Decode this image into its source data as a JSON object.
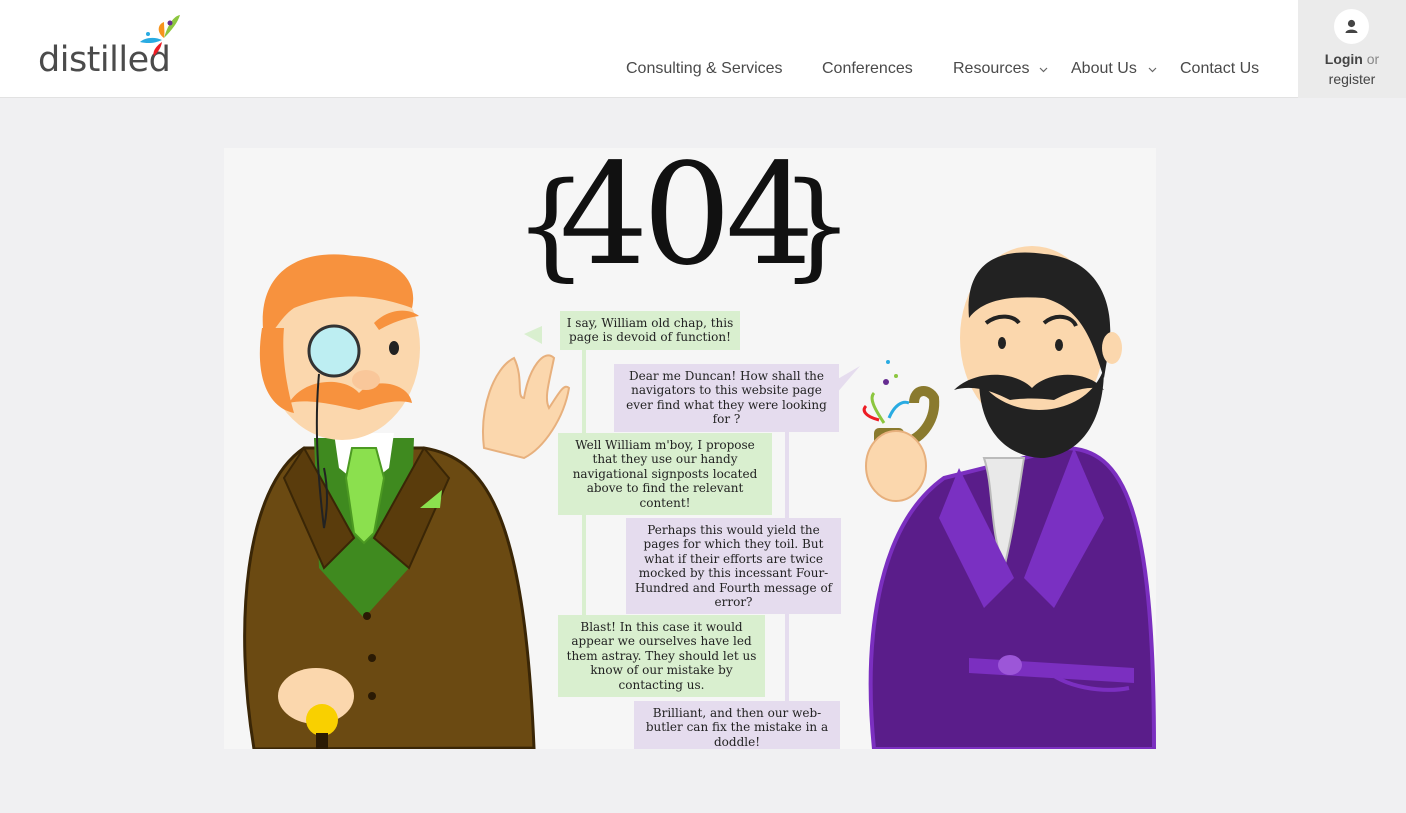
{
  "header": {
    "logo_text": "distilled",
    "nav": [
      {
        "label": "Consulting & Services",
        "has_dropdown": false
      },
      {
        "label": "Conferences",
        "has_dropdown": false
      },
      {
        "label": "Resources",
        "has_dropdown": true
      },
      {
        "label": "About Us",
        "has_dropdown": true
      },
      {
        "label": "Contact Us",
        "has_dropdown": false
      }
    ],
    "login": {
      "icon": "user-icon",
      "login_label": "Login",
      "or_label": "or",
      "register_label": "register"
    }
  },
  "illustration": {
    "title": {
      "open_brace": "{",
      "digits": "404",
      "close_brace": "}"
    },
    "dialogue": [
      {
        "speaker": "left",
        "text": "I say, William old chap, this page is devoid of function!"
      },
      {
        "speaker": "right",
        "text": "Dear me Duncan! How shall the navigators to this website page ever find what they were looking for ?"
      },
      {
        "speaker": "left",
        "text": "Well William m'boy, I propose that they use our handy navigational signposts located above to find the relevant content!"
      },
      {
        "speaker": "right",
        "text": "Perhaps this would yield the pages for which they toil. But what if their efforts are twice mocked by this incessant Four-Hundred and Fourth message of error?"
      },
      {
        "speaker": "left",
        "text": "Blast! In this case it would appear we ourselves have led them astray. They should let us know of our mistake by contacting us."
      },
      {
        "speaker": "right",
        "text": "Brilliant, and then our web-butler can fix the mistake in a doddle!"
      }
    ]
  },
  "colors": {
    "page_bg": "#f0f0f2",
    "green_bubble": "#d9efcf",
    "purple_bubble": "#e5dcee",
    "left_suit": "#6b4a12",
    "right_robe": "#5a1d8a"
  }
}
